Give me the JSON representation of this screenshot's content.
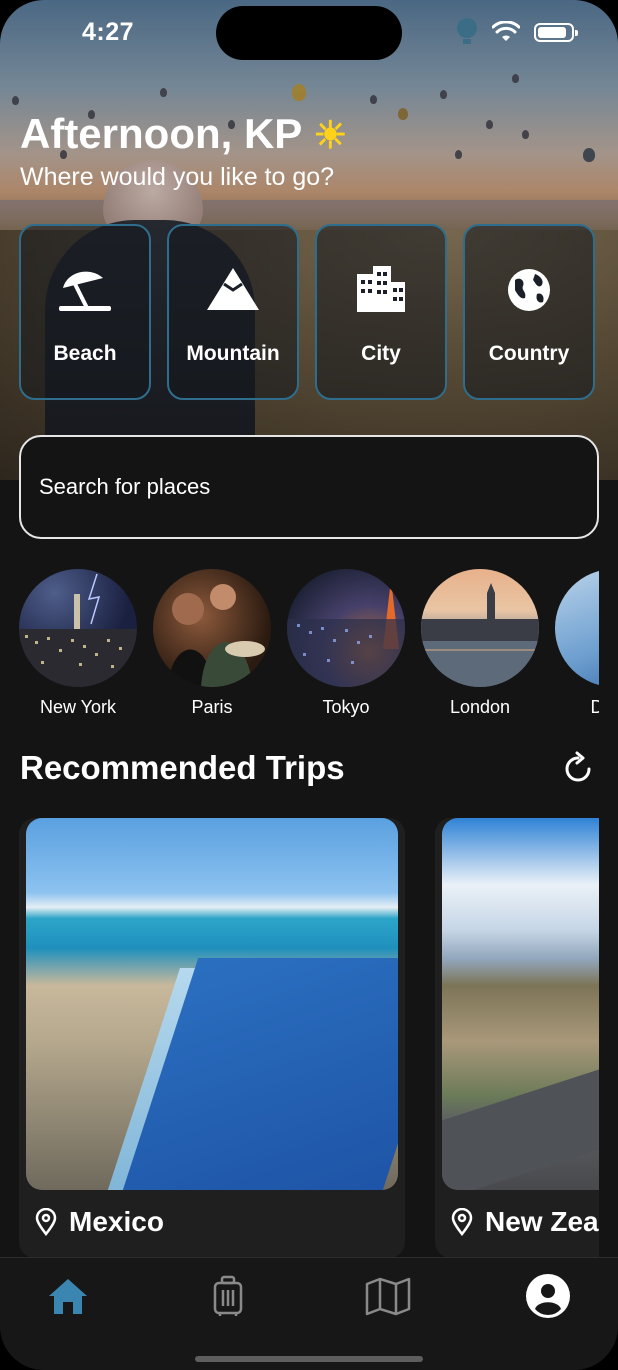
{
  "status_bar": {
    "time": "4:27",
    "battery_level": 0.9
  },
  "header": {
    "greeting": "Afternoon, KP",
    "weather_icon": "sun-icon",
    "subtitle": "Where would you like to go?"
  },
  "categories": [
    {
      "label": "Beach",
      "icon": "beach-umbrella-icon"
    },
    {
      "label": "Mountain",
      "icon": "mountain-icon"
    },
    {
      "label": "City",
      "icon": "city-buildings-icon"
    },
    {
      "label": "Country",
      "icon": "globe-icon"
    }
  ],
  "search": {
    "placeholder": "Search for places"
  },
  "cities": [
    {
      "name": "New York"
    },
    {
      "name": "Paris"
    },
    {
      "name": "Tokyo"
    },
    {
      "name": "London"
    },
    {
      "name": "Dubai"
    }
  ],
  "recommended": {
    "title": "Recommended Trips",
    "trips": [
      {
        "place": "Mexico"
      },
      {
        "place": "New Zealand"
      }
    ]
  },
  "tab_bar": {
    "items": [
      {
        "name": "home",
        "icon": "home-icon",
        "active": true
      },
      {
        "name": "trips",
        "icon": "suitcase-icon",
        "active": false
      },
      {
        "name": "map",
        "icon": "map-icon",
        "active": false
      },
      {
        "name": "profile",
        "icon": "profile-icon",
        "active": false
      }
    ]
  },
  "colors": {
    "accent": "#3a86b0",
    "card_border": "#2e6e8c",
    "background": "#141414"
  }
}
